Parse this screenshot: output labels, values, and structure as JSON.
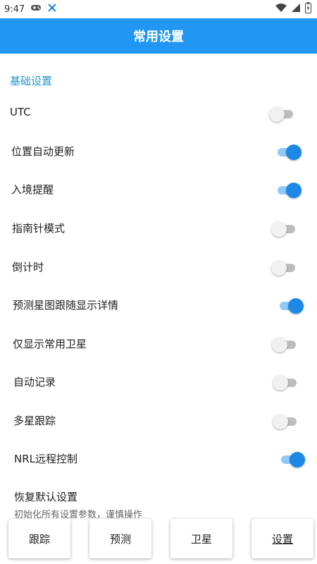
{
  "status": {
    "time": "9:47"
  },
  "app_title": "常用设置",
  "section": "基础设置",
  "settings": [
    {
      "label": "UTC",
      "on": false
    },
    {
      "label": "位置自动更新",
      "on": true
    },
    {
      "label": "入境提醒",
      "on": true
    },
    {
      "label": "指南针模式",
      "on": false
    },
    {
      "label": "倒计时",
      "on": false
    },
    {
      "label": "预测星图跟随显示详情",
      "on": true
    },
    {
      "label": "仅显示常用卫星",
      "on": false
    },
    {
      "label": "自动记录",
      "on": false
    },
    {
      "label": "多星跟踪",
      "on": false
    },
    {
      "label": "NRL远程控制",
      "on": true
    }
  ],
  "restore": {
    "title": "恢复默认设置",
    "subtitle": "初始化所有设置参数，谨慎操作"
  },
  "nav": [
    "跟踪",
    "预测",
    "卫星",
    "设置"
  ],
  "active_nav": 3,
  "colors": {
    "appbar": "#2196f3",
    "toggle_on": "#1e88e5",
    "section": "#2196c9"
  }
}
